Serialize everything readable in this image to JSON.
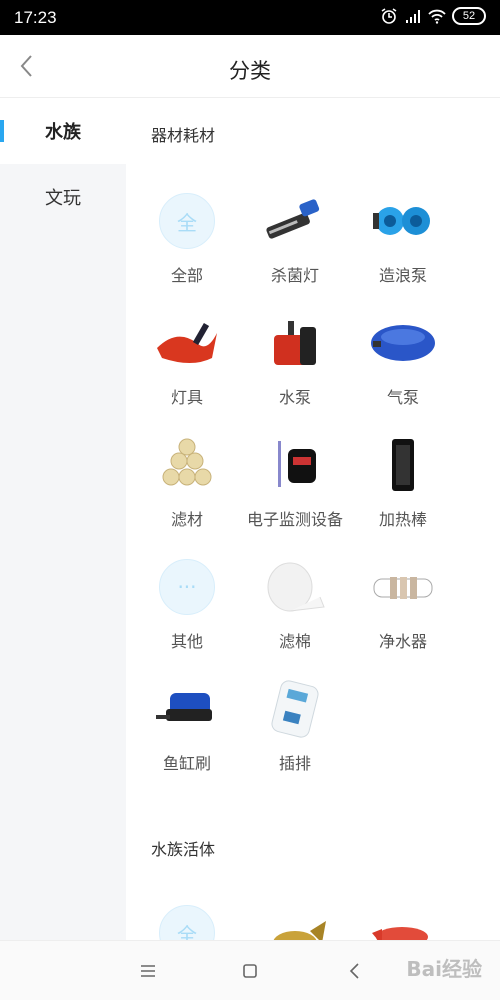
{
  "status_bar": {
    "time": "17:23",
    "battery": "52"
  },
  "header": {
    "title": "分类"
  },
  "sidebar": {
    "items": [
      {
        "label": "水族"
      },
      {
        "label": "文玩"
      }
    ]
  },
  "sections": [
    {
      "title": "器材耗材",
      "items": [
        {
          "label": "全部",
          "icon": "all-icon",
          "placeholder_char": "全"
        },
        {
          "label": "杀菌灯",
          "icon": "uv-lamp-icon"
        },
        {
          "label": "造浪泵",
          "icon": "wave-pump-icon"
        },
        {
          "label": "灯具",
          "icon": "light-fixture-icon"
        },
        {
          "label": "水泵",
          "icon": "water-pump-icon"
        },
        {
          "label": "气泵",
          "icon": "air-pump-icon"
        },
        {
          "label": "滤材",
          "icon": "filter-media-icon"
        },
        {
          "label": "电子监测设备",
          "icon": "monitor-device-icon"
        },
        {
          "label": "加热棒",
          "icon": "heater-icon"
        },
        {
          "label": "其他",
          "icon": "more-icon",
          "placeholder_char": "···"
        },
        {
          "label": "滤棉",
          "icon": "filter-cotton-icon"
        },
        {
          "label": "净水器",
          "icon": "water-purifier-icon"
        },
        {
          "label": "鱼缸刷",
          "icon": "tank-brush-icon"
        },
        {
          "label": "插排",
          "icon": "power-strip-icon"
        }
      ]
    },
    {
      "title": "水族活体",
      "items": [
        {
          "icon": "all-icon",
          "placeholder_char": "全"
        },
        {
          "icon": "gold-fish-icon"
        },
        {
          "icon": "red-fish-icon"
        }
      ]
    }
  ],
  "watermark": "Bai经验",
  "colors": {
    "accent": "#2aa7f0",
    "sidebar_bg": "#f5f6f8"
  }
}
